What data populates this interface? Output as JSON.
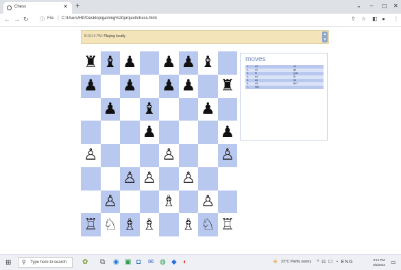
{
  "browser": {
    "tab_title": "Chess",
    "new_tab": "+",
    "url_scheme_label": "File",
    "url": "C:/Users/HP/Desktop/gaming%20project/chess.html"
  },
  "status": {
    "time": "8:10:14 PM:",
    "message": "Playing locally"
  },
  "board": {
    "colors": {
      "light": "#ffffff",
      "dark": "#b9c8ef"
    },
    "rows": [
      [
        "♜",
        "♝",
        "♟",
        "",
        "♟",
        "♟",
        "♝",
        ""
      ],
      [
        "♟",
        "",
        "♟",
        "",
        "♟",
        "♟",
        "",
        "♜"
      ],
      [
        "",
        "♟",
        "",
        "♝",
        "",
        "",
        "♟",
        ""
      ],
      [
        "",
        "",
        "",
        "♟",
        "",
        "",
        "",
        "♟"
      ],
      [
        "♙",
        "",
        "",
        "",
        "♙",
        "",
        "",
        "♙"
      ],
      [
        "",
        "",
        "♙",
        "♙",
        "",
        "♙",
        "",
        ""
      ],
      [
        "",
        "♙",
        "",
        "",
        "♗",
        "",
        "♙",
        ""
      ],
      [
        "♖",
        "♘",
        "♗",
        "♗",
        "",
        "♗",
        "♘",
        "♖"
      ]
    ]
  },
  "moves": {
    "title": "moves",
    "rows": [
      [
        "1.",
        "e4",
        "e5"
      ],
      [
        "2.",
        "c3",
        "g6"
      ],
      [
        "3.",
        "f3",
        "Qd6"
      ],
      [
        "4.",
        "b4",
        "f5"
      ],
      [
        "5.",
        "a4",
        "b6"
      ],
      [
        "6.",
        "d3",
        "Bb7"
      ],
      [
        "7.",
        "Ne2",
        ""
      ]
    ]
  },
  "taskbar": {
    "search_placeholder": "Type here to search",
    "weather": "22°C  Partly sunny",
    "time": "8:12 PM",
    "date": "6/5/2023"
  }
}
